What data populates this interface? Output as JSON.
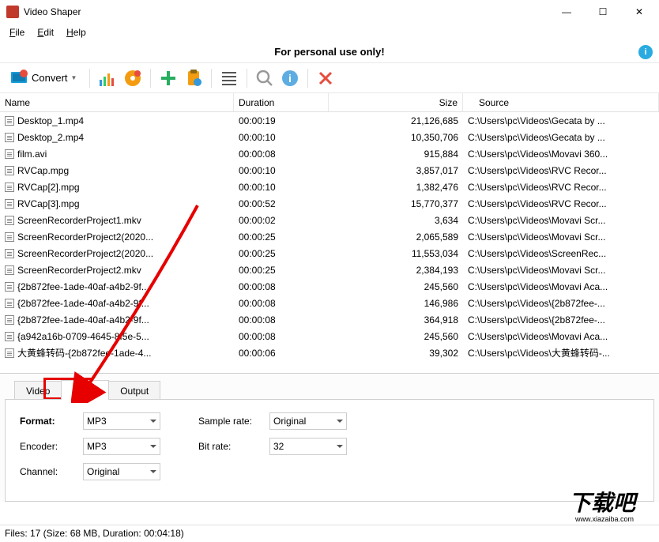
{
  "window": {
    "title": "Video Shaper"
  },
  "menu": {
    "file": "File",
    "edit": "Edit",
    "help": "Help"
  },
  "banner": {
    "text": "For personal use only!"
  },
  "toolbar": {
    "convert": "Convert"
  },
  "columns": {
    "name": "Name",
    "duration": "Duration",
    "size": "Size",
    "source": "Source"
  },
  "files": [
    {
      "name": "Desktop_1.mp4",
      "duration": "00:00:19",
      "size": "21,126,685",
      "source": "C:\\Users\\pc\\Videos\\Gecata by ..."
    },
    {
      "name": "Desktop_2.mp4",
      "duration": "00:00:10",
      "size": "10,350,706",
      "source": "C:\\Users\\pc\\Videos\\Gecata by ..."
    },
    {
      "name": "film.avi",
      "duration": "00:00:08",
      "size": "915,884",
      "source": "C:\\Users\\pc\\Videos\\Movavi 360..."
    },
    {
      "name": "RVCap.mpg",
      "duration": "00:00:10",
      "size": "3,857,017",
      "source": "C:\\Users\\pc\\Videos\\RVC Recor..."
    },
    {
      "name": "RVCap[2].mpg",
      "duration": "00:00:10",
      "size": "1,382,476",
      "source": "C:\\Users\\pc\\Videos\\RVC Recor..."
    },
    {
      "name": "RVCap[3].mpg",
      "duration": "00:00:52",
      "size": "15,770,377",
      "source": "C:\\Users\\pc\\Videos\\RVC Recor..."
    },
    {
      "name": "ScreenRecorderProject1.mkv",
      "duration": "00:00:02",
      "size": "3,634",
      "source": "C:\\Users\\pc\\Videos\\Movavi Scr..."
    },
    {
      "name": "ScreenRecorderProject2(2020...",
      "duration": "00:00:25",
      "size": "2,065,589",
      "source": "C:\\Users\\pc\\Videos\\Movavi Scr..."
    },
    {
      "name": "ScreenRecorderProject2(2020...",
      "duration": "00:00:25",
      "size": "11,553,034",
      "source": "C:\\Users\\pc\\Videos\\ScreenRec..."
    },
    {
      "name": "ScreenRecorderProject2.mkv",
      "duration": "00:00:25",
      "size": "2,384,193",
      "source": "C:\\Users\\pc\\Videos\\Movavi Scr..."
    },
    {
      "name": "{2b872fee-1ade-40af-a4b2-9f...",
      "duration": "00:00:08",
      "size": "245,560",
      "source": "C:\\Users\\pc\\Videos\\Movavi Aca..."
    },
    {
      "name": "{2b872fee-1ade-40af-a4b2-9f...",
      "duration": "00:00:08",
      "size": "146,986",
      "source": "C:\\Users\\pc\\Videos\\{2b872fee-..."
    },
    {
      "name": "{2b872fee-1ade-40af-a4b2-9f...",
      "duration": "00:00:08",
      "size": "364,918",
      "source": "C:\\Users\\pc\\Videos\\{2b872fee-..."
    },
    {
      "name": "{a942a16b-0709-4645-8f5e-5...",
      "duration": "00:00:08",
      "size": "245,560",
      "source": "C:\\Users\\pc\\Videos\\Movavi Aca..."
    },
    {
      "name": "大黄蜂转码-{2b872fee-1ade-4...",
      "duration": "00:00:06",
      "size": "39,302",
      "source": "C:\\Users\\pc\\Videos\\大黄蜂转码-..."
    }
  ],
  "tabs": {
    "video": "Video",
    "audio": "Audio",
    "output": "Output"
  },
  "form": {
    "format_label": "Format:",
    "format_value": "MP3",
    "encoder_label": "Encoder:",
    "encoder_value": "MP3",
    "channel_label": "Channel:",
    "channel_value": "Original",
    "samplerate_label": "Sample rate:",
    "samplerate_value": "Original",
    "bitrate_label": "Bit rate:",
    "bitrate_value": "32"
  },
  "status": {
    "text": "Files: 17 (Size: 68 MB, Duration: 00:04:18)"
  },
  "watermark": {
    "url": "www.xiazaiba.com"
  }
}
